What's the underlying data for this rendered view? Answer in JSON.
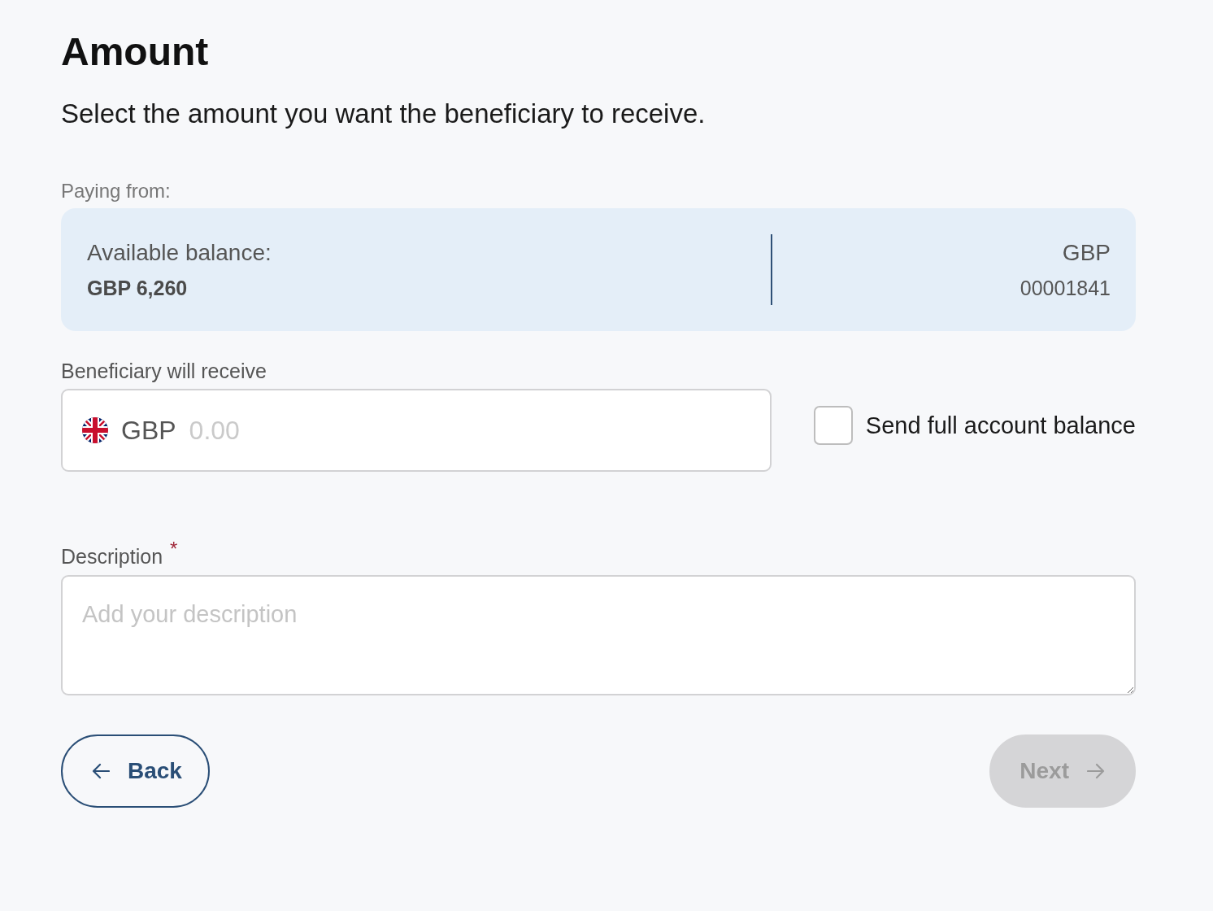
{
  "header": {
    "title": "Amount",
    "subtitle": "Select the amount you want the beneficiary to receive."
  },
  "paying_from": {
    "label": "Paying from:",
    "balance_label": "Available balance:",
    "balance": "GBP 6,260",
    "currency": "GBP",
    "account_number": "00001841"
  },
  "amount": {
    "label": "Beneficiary will receive",
    "currency": "GBP",
    "placeholder": "0.00"
  },
  "full_balance": {
    "label": "Send full account balance",
    "checked": false
  },
  "description": {
    "label": "Description",
    "required_mark": "*",
    "placeholder": "Add your description"
  },
  "buttons": [
    {
      "kind": "back",
      "label": "Back",
      "disabled": false
    },
    {
      "kind": "next",
      "label": "Next",
      "disabled": true
    }
  ]
}
